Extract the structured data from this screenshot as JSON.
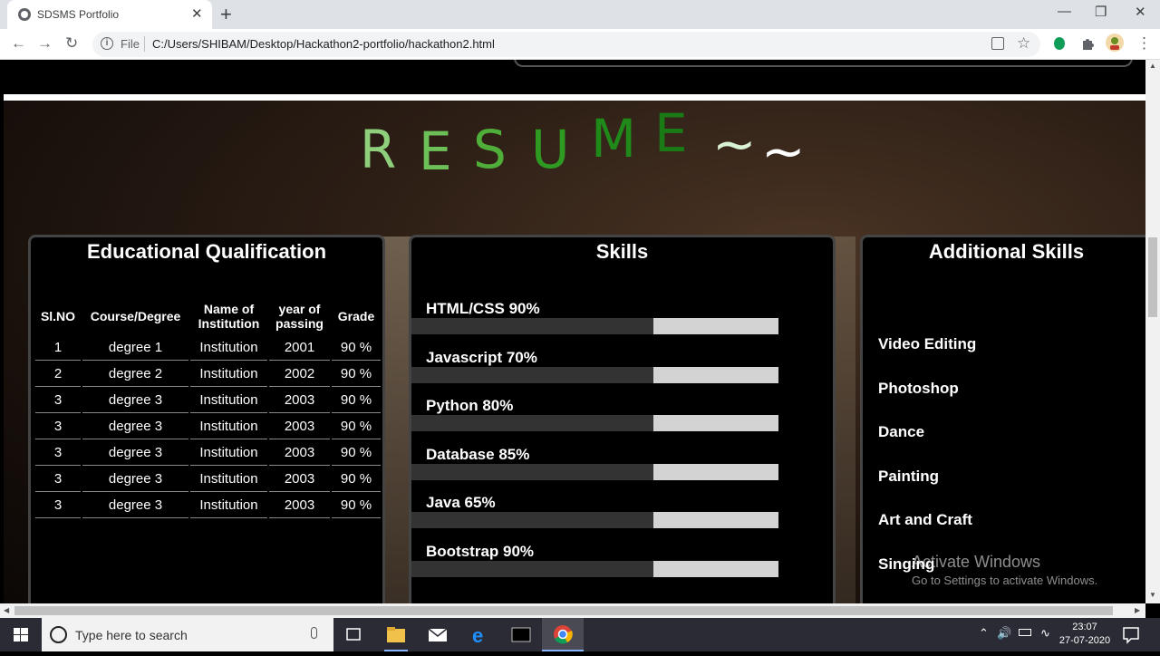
{
  "browser": {
    "tab_title": "SDSMS Portfolio",
    "tab_close": "✕",
    "new_tab": "+",
    "url_scheme": "File",
    "url": "C:/Users/SHIBAM/Desktop/Hackathon2-portfolio/hackathon2.html",
    "window_controls": {
      "minimize": "—",
      "maximize": "❐",
      "close": "✕"
    }
  },
  "resume": {
    "title_letters": [
      "R",
      "E",
      "S",
      "U",
      "M",
      "E",
      "~",
      "~"
    ],
    "letter_colors": [
      "#8fce7a",
      "#6dbf58",
      "#4fae3a",
      "#2e9a22",
      "#1f8a1a",
      "#1a7a16",
      "#d9f2d3",
      "#ffffff"
    ]
  },
  "education": {
    "heading": "Educational Qualification",
    "columns": [
      "Sl.NO",
      "Course/Degree",
      "Name of Institution",
      "year of passing",
      "Grade"
    ],
    "rows": [
      [
        "1",
        "degree 1",
        "Institution",
        "2001",
        "90 %"
      ],
      [
        "2",
        "degree 2",
        "Institution",
        "2002",
        "90 %"
      ],
      [
        "3",
        "degree 3",
        "Institution",
        "2003",
        "90 %"
      ],
      [
        "3",
        "degree 3",
        "Institution",
        "2003",
        "90 %"
      ],
      [
        "3",
        "degree 3",
        "Institution",
        "2003",
        "90 %"
      ],
      [
        "3",
        "degree 3",
        "Institution",
        "2003",
        "90 %"
      ],
      [
        "3",
        "degree 3",
        "Institution",
        "2003",
        "90 %"
      ]
    ]
  },
  "skills": {
    "heading": "Skills",
    "items": [
      {
        "label": "HTML/CSS 90%",
        "level": 0.66
      },
      {
        "label": "Javascript 70%",
        "level": 0.66
      },
      {
        "label": "Python 80%",
        "level": 0.66
      },
      {
        "label": "Database 85%",
        "level": 0.66
      },
      {
        "label": "Java 65%",
        "level": 0.66
      },
      {
        "label": "Bootstrap 90%",
        "level": 0.66
      }
    ]
  },
  "additional_skills": {
    "heading": "Additional Skills",
    "items": [
      "Video Editing",
      "Photoshop",
      "Dance",
      "Painting",
      "Art and Craft",
      "Singing"
    ]
  },
  "watermark": {
    "line1": "Activate Windows",
    "line2": "Go to Settings to activate Windows."
  },
  "taskbar": {
    "search_placeholder": "Type here to search",
    "time": "23:07",
    "date": "27-07-2020"
  }
}
